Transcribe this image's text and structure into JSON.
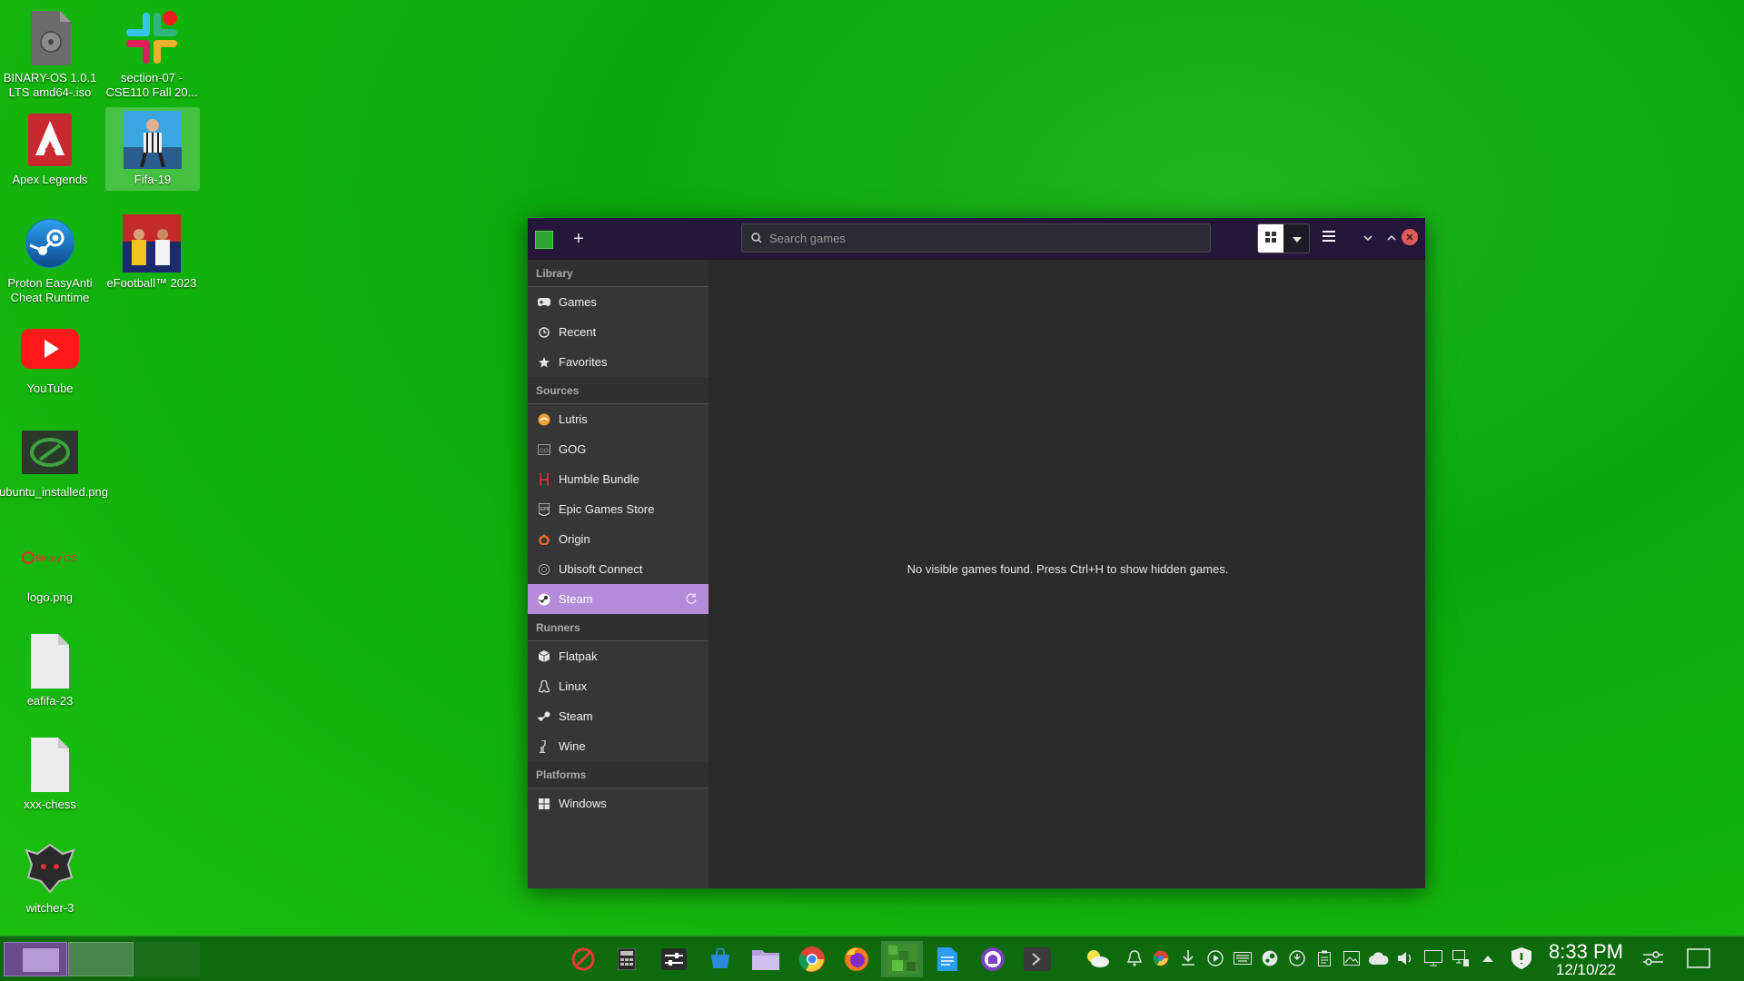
{
  "desktop": {
    "icons": [
      {
        "label": "BINARY-OS 1.0.1 LTS amd64-.iso",
        "icon": "disc-image-icon"
      },
      {
        "label": "section-07 - CSE110 Fall 20...",
        "icon": "slack-icon"
      },
      {
        "label": "Apex Legends",
        "icon": "apex-legends-icon"
      },
      {
        "label": "Fifa-19",
        "icon": "fifa-19-icon"
      },
      {
        "label": "Proton EasyAnti Cheat Runtime",
        "icon": "steam-icon"
      },
      {
        "label": "eFootball™ 2023",
        "icon": "efootball-icon"
      },
      {
        "label": "YouTube",
        "icon": "youtube-icon"
      },
      {
        "label": "ubuntu_installed.png",
        "icon": "image-file-icon"
      },
      {
        "label": "logo.png",
        "icon": "binary-os-logo-icon"
      },
      {
        "label": "eafifa-23",
        "icon": "file-icon"
      },
      {
        "label": "xxx-chess",
        "icon": "file-icon"
      },
      {
        "label": "witcher-3",
        "icon": "witcher-icon"
      }
    ],
    "logo_text": "Binary OS"
  },
  "lutris": {
    "add_label": "+",
    "search_placeholder": "Search games",
    "sidebar": {
      "library_header": "Library",
      "library": [
        "Games",
        "Recent",
        "Favorites"
      ],
      "sources_header": "Sources",
      "sources": [
        "Lutris",
        "GOG",
        "Humble Bundle",
        "Epic Games Store",
        "Origin",
        "Ubisoft Connect",
        "Steam"
      ],
      "active_source": "Steam",
      "runners_header": "Runners",
      "runners": [
        "Flatpak",
        "Linux",
        "Steam",
        "Wine"
      ],
      "platforms_header": "Platforms",
      "platforms": [
        "Windows"
      ]
    },
    "empty_message": "No visible games found. Press Ctrl+H to show hidden games.",
    "accent_color": "#b48cd9",
    "titlebar_color": "#25173a"
  },
  "taskbar": {
    "apps": [
      "no-entry-icon",
      "calculator-icon",
      "settings-sliders-icon",
      "store-icon",
      "file-manager-icon",
      "chrome-icon",
      "firefox-icon",
      "lutris-icon",
      "text-editor-icon",
      "github-icon",
      "terminal-icon"
    ],
    "active_app": "lutris-icon",
    "tray": [
      "weather-icon",
      "notification-icon",
      "chrome-tray-icon",
      "download-icon",
      "media-play-icon",
      "keyboard-icon",
      "steam-tray-icon",
      "update-icon",
      "clipboard-icon",
      "screenshot-icon",
      "cloud-icon",
      "volume-icon",
      "display-icon",
      "network-icon",
      "expand-tray-icon",
      "security-shield-icon"
    ],
    "time": "8:33 PM",
    "date": "12/10/22"
  }
}
